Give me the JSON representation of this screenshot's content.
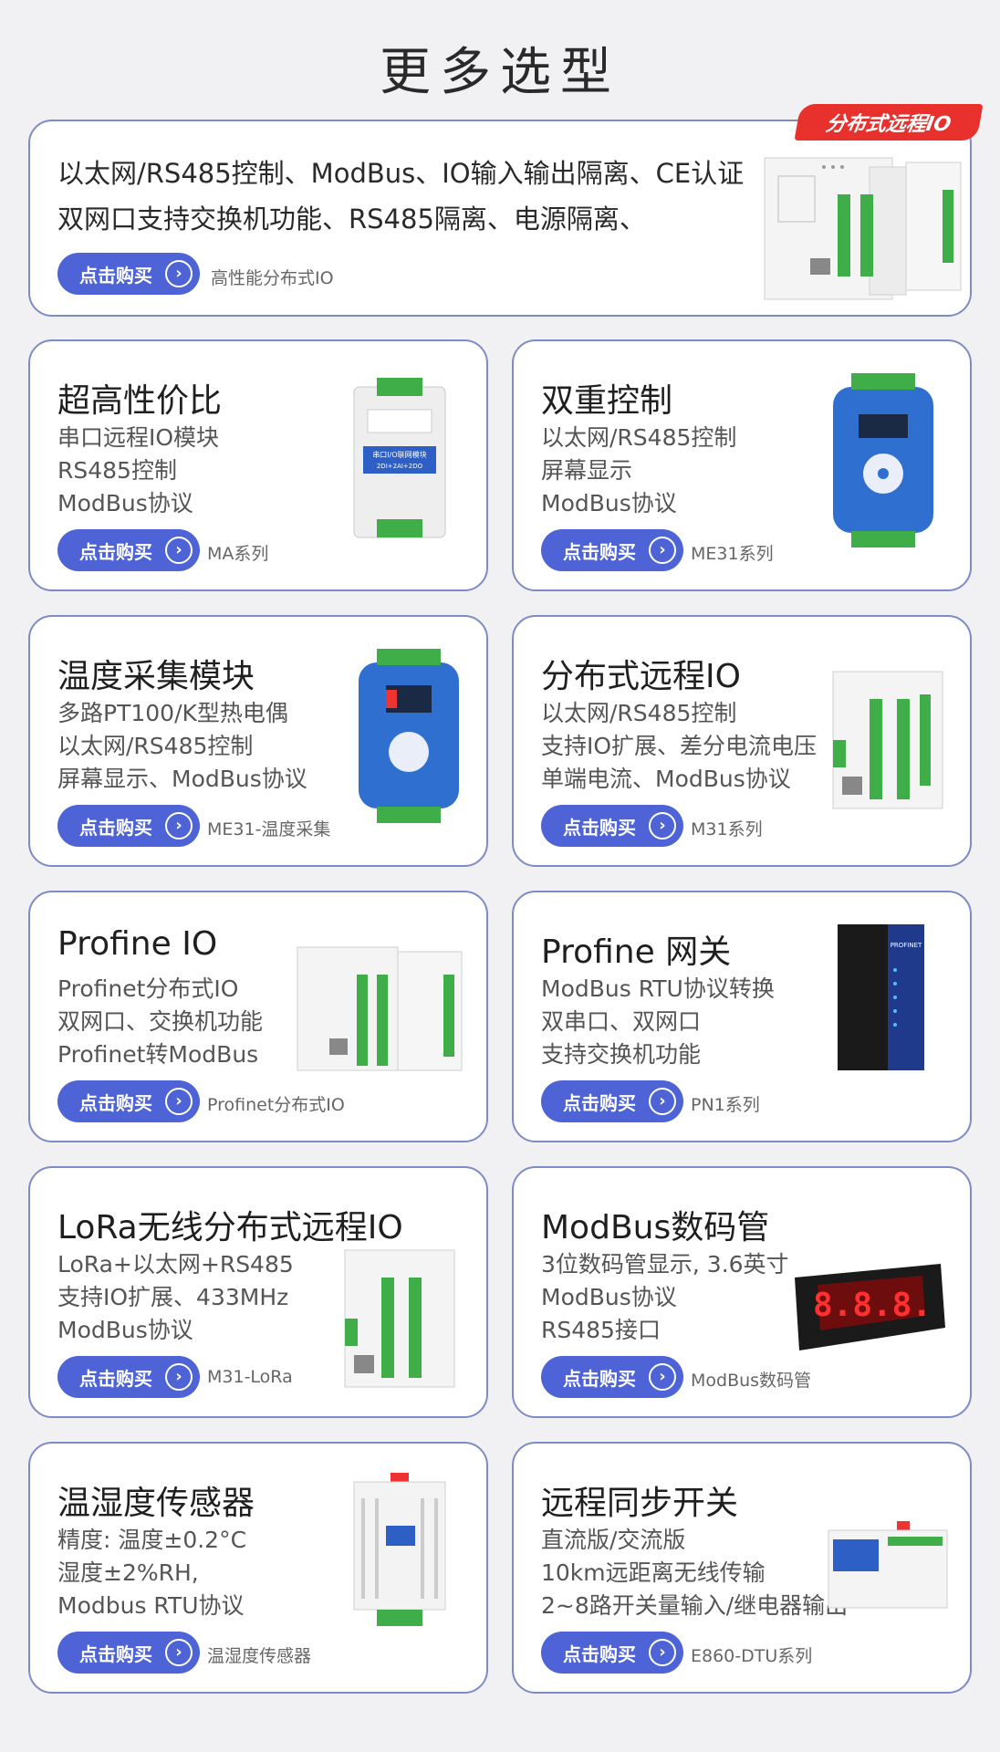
{
  "page_title": "更多选型",
  "buy_label": "点击购买",
  "arrow_icon": "chevron-right-circle-icon",
  "featured": {
    "badge": "分布式远程IO",
    "line1": "以太网/RS485控制、ModBus、IO输入输出隔离、CE认证",
    "line2": "双网口支持交换机功能、RS485隔离、电源隔离、",
    "series": "高性能分布式IO"
  },
  "cards": [
    {
      "title": "超高性价比",
      "lines": [
        "串口远程IO模块",
        "RS485控制",
        "ModBus协议"
      ],
      "series": "MA系列"
    },
    {
      "title": "双重控制",
      "lines": [
        "以太网/RS485控制",
        "屏幕显示",
        "ModBus协议"
      ],
      "series": "ME31系列"
    },
    {
      "title": "温度采集模块",
      "lines": [
        "多路PT100/K型热电偶",
        "以太网/RS485控制",
        "屏幕显示、ModBus协议"
      ],
      "series": "ME31-温度采集"
    },
    {
      "title": "分布式远程IO",
      "lines": [
        "以太网/RS485控制",
        "支持IO扩展、差分电流电压",
        "单端电流、ModBus协议"
      ],
      "series": "M31系列"
    },
    {
      "title": "Profine IO",
      "lines": [
        "Profinet分布式IO",
        "双网口、交换机功能",
        "Profinet转ModBus"
      ],
      "series": "Profinet分布式IO"
    },
    {
      "title": "Profine 网关",
      "lines": [
        "ModBus RTU协议转换",
        "双串口、双网口",
        "支持交换机功能"
      ],
      "series": "PN1系列"
    },
    {
      "title": "LoRa无线分布式远程IO",
      "lines": [
        "LoRa+以太网+RS485",
        "支持IO扩展、433MHz",
        "ModBus协议"
      ],
      "series": "M31-LoRa"
    },
    {
      "title": "ModBus数码管",
      "lines": [
        "3位数码管显示, 3.6英寸",
        "ModBus协议",
        "RS485接口"
      ],
      "series": "ModBus数码管"
    },
    {
      "title": "温湿度传感器",
      "lines": [
        "精度: 温度±0.2°C",
        "湿度±2%RH,",
        "Modbus   RTU协议"
      ],
      "series": "温湿度传感器"
    },
    {
      "title": "远程同步开关",
      "lines": [
        "直流版/交流版",
        "10km远距离无线传输",
        "2~8路开关量输入/继电器输出"
      ],
      "series": "E860-DTU系列"
    }
  ],
  "product_texts": {
    "ma_label": "串口I/O联网模块",
    "ma_sub": "2DI+2AI+2DO",
    "digits": "8.8.8.",
    "profinet": "PROFINET"
  },
  "colors": {
    "accent": "#4d63d6",
    "card_border": "#7f8bc4",
    "badge_red": "#e8312c",
    "terminal_green": "#3fae49",
    "device_blue": "#2f6fd0"
  }
}
